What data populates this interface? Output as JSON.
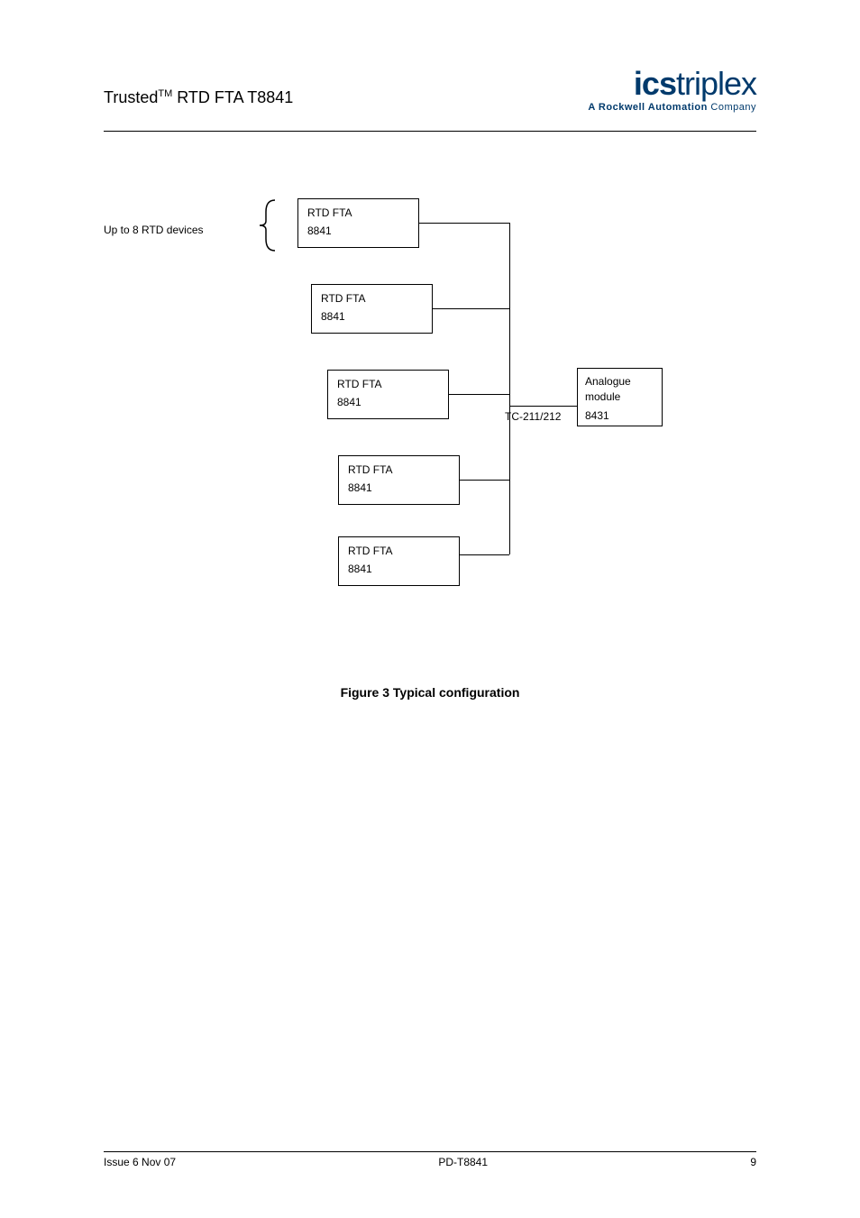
{
  "header": {
    "title_prefix": "Trusted",
    "title_tm": "TM",
    "title_suffix": " RTD FTA T8841"
  },
  "logo": {
    "ics": "ics",
    "triplex": "triplex",
    "tagline_bold": "A Rockwell Automation",
    "tagline_company": " Company"
  },
  "diagram": {
    "left_label": "Up to 8 RTD devices",
    "rtd_boxes": [
      {
        "line1": "RTD FTA",
        "line2": "8841"
      },
      {
        "line1": "RTD FTA",
        "line2": "8841"
      },
      {
        "line1": "RTD FTA",
        "line2": "8841"
      },
      {
        "line1": "RTD FTA",
        "line2": "8841"
      },
      {
        "line1": "RTD FTA",
        "line2": "8841"
      }
    ],
    "tc_label": "TC-211/212",
    "analogue_box": {
      "line1": "Analogue",
      "line2": "module",
      "line3": "8431"
    }
  },
  "figure_caption": "Figure 3 Typical configuration",
  "footer": {
    "issue": "Issue 6 Nov 07",
    "doc_id": "PD-T8841",
    "page": "9"
  }
}
